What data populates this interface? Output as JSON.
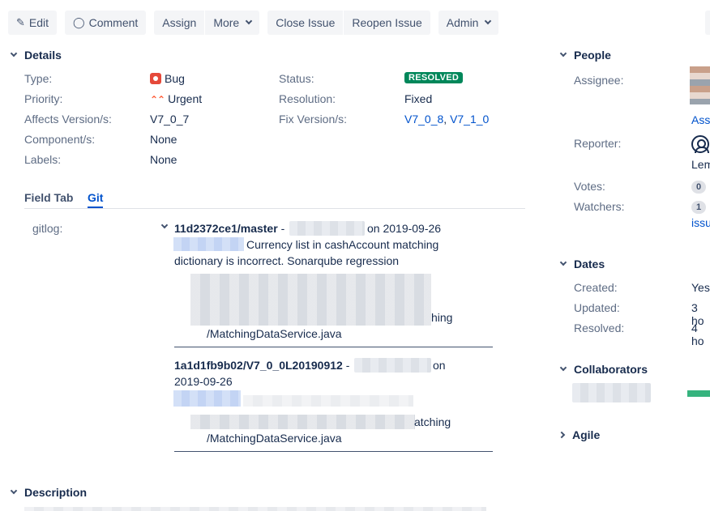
{
  "toolbar": {
    "edit": "Edit",
    "comment": "Comment",
    "assign": "Assign",
    "more": "More",
    "close_issue": "Close Issue",
    "reopen_issue": "Reopen Issue",
    "admin": "Admin"
  },
  "details": {
    "title": "Details",
    "type_label": "Type:",
    "type_value": "Bug",
    "priority_label": "Priority:",
    "priority_value": "Urgent",
    "affects_label": "Affects Version/s:",
    "affects_value": "V7_0_7",
    "component_label": "Component/s:",
    "component_value": "None",
    "labels_label": "Labels:",
    "labels_value": "None",
    "status_label": "Status:",
    "status_value": "RESOLVED",
    "resolution_label": "Resolution:",
    "resolution_value": "Fixed",
    "fix_label": "Fix Version/s:",
    "fix_values": [
      "V7_0_8",
      "V7_1_0"
    ],
    "fix_sep": ","
  },
  "tabs": {
    "field_tab": "Field Tab",
    "git": "Git"
  },
  "git": {
    "label": "gitlog:",
    "commits": [
      {
        "ref": "11d2372ce1/master",
        "dash": "-",
        "on": "on 2019-09-26",
        "message_line1": "Currency list in cashAccount matching",
        "message_line2": "dictionary is incorrect. Sonarqube regression",
        "file_tail": "hing",
        "file_path": "/MatchingDataService.java"
      },
      {
        "ref": "1a1d1fb9b02/V7_0_0L20190912",
        "dash": "-",
        "on": "on",
        "date": "2019-09-26",
        "file_tail": "atching",
        "file_path": "/MatchingDataService.java"
      }
    ]
  },
  "people": {
    "title": "People",
    "assignee_label": "Assignee:",
    "assign_link": "Assi",
    "reporter_label": "Reporter:",
    "reporter_name": "Lem",
    "votes_label": "Votes:",
    "votes_value": "0",
    "watchers_label": "Watchers:",
    "watchers_value": "1",
    "watchers_link": "issu"
  },
  "dates": {
    "title": "Dates",
    "created_label": "Created:",
    "created_value": "Yes",
    "updated_label": "Updated:",
    "updated_value": "3 ho",
    "resolved_label": "Resolved:",
    "resolved_value": "4 ho"
  },
  "collaborators": {
    "title": "Collaborators"
  },
  "agile": {
    "title": "Agile"
  },
  "description": {
    "title": "Description"
  }
}
